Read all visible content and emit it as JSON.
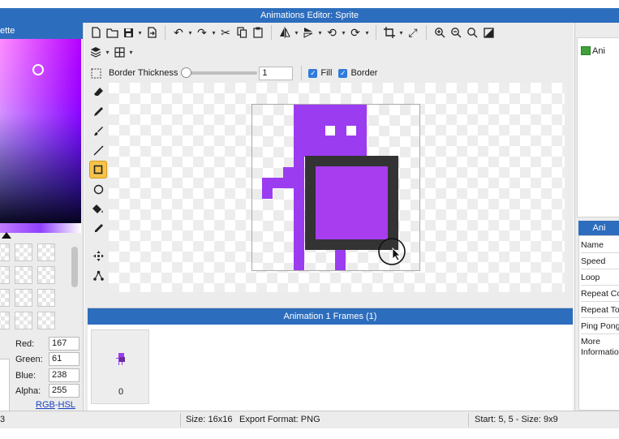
{
  "window": {
    "title": "Animations Editor: Sprite"
  },
  "palette": {
    "title": "ette",
    "channels": [
      {
        "label": "Red:",
        "value": "167"
      },
      {
        "label": "Green:",
        "value": "61"
      },
      {
        "label": "Blue:",
        "value": "238"
      },
      {
        "label": "Alpha:",
        "value": "255"
      }
    ],
    "mode_links": {
      "rgb": "RGB",
      "sep": "-",
      "hsl": "HSL"
    }
  },
  "toolbar": {
    "row1_icons": [
      "new-file-icon",
      "open-folder-icon",
      "save-icon",
      "export-icon",
      "undo-icon",
      "redo-icon",
      "cut-icon",
      "copy-icon",
      "paste-icon",
      "flip-horizontal-icon",
      "flip-vertical-icon",
      "rotate-left-icon",
      "rotate-right-icon",
      "crop-icon",
      "resize-icon",
      "zoom-in-icon",
      "zoom-out-icon",
      "zoom-fit-icon",
      "toggle-view-icon"
    ],
    "row2_icons": [
      "layers-icon",
      "grid-icon"
    ]
  },
  "options": {
    "border_thickness_label": "Border Thickness",
    "border_thickness_value": "1",
    "border_thickness_slider": 0.0,
    "fill_label": "Fill",
    "fill_checked": true,
    "border_label": "Border",
    "border_checked": true
  },
  "tools": [
    {
      "name": "eraser-icon",
      "active": false
    },
    {
      "name": "pencil-icon",
      "active": false
    },
    {
      "name": "brush-icon",
      "active": false
    },
    {
      "name": "line-icon",
      "active": false
    },
    {
      "name": "rectangle-icon",
      "active": true
    },
    {
      "name": "ellipse-icon",
      "active": false
    },
    {
      "name": "paint-bucket-icon",
      "active": false
    },
    {
      "name": "eyedropper-icon",
      "active": false
    },
    {
      "name": "move-icon",
      "active": false
    },
    {
      "name": "node-icon",
      "active": false
    }
  ],
  "colors": {
    "accent": "#2d6dbd",
    "sprite": "#9b3cf0",
    "rect_border": "#333333",
    "rect_fill": "#a73dee"
  },
  "frames": {
    "title": "Animation 1 Frames (1)",
    "items": [
      {
        "index": "0"
      }
    ]
  },
  "animations": {
    "items": [
      {
        "label": "Ani"
      }
    ],
    "properties_title": "Ani",
    "properties": [
      "Name",
      "Speed",
      "Loop",
      "Repeat Co",
      "Repeat To",
      "Ping Pong",
      "More Information"
    ]
  },
  "status": {
    "left": "3",
    "size": "Size: 16x16",
    "export": "Export Format: PNG",
    "selection": "Start: 5, 5 - Size: 9x9"
  }
}
